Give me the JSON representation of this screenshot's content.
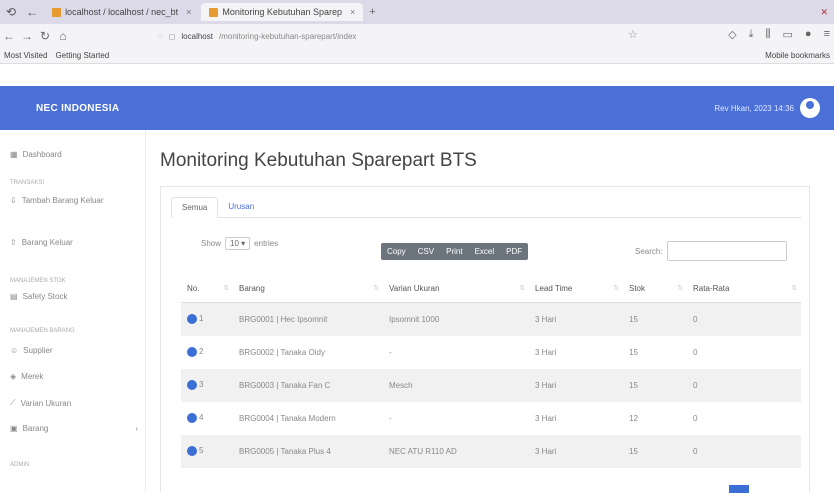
{
  "browser": {
    "tabs": [
      {
        "label": "localhost / localhost / nec_bt"
      },
      {
        "label": "Monitoring Kebutuhan Sparep"
      }
    ],
    "url_host": "localhost",
    "url_path": "/monitoring-kebutuhan-sparepart/index",
    "bookmarks": [
      "Most Visited",
      "Getting Started"
    ],
    "bookmarks_right": "Mobile bookmarks"
  },
  "header": {
    "brand": "NEC INDONESIA",
    "user": "Rev Hkan, 2023 14:36"
  },
  "sidebar": {
    "items": [
      {
        "label": "Dashboard",
        "icon": "grid-icon",
        "section": false
      },
      {
        "label": "Transaksi",
        "section": true
      },
      {
        "label": "Tambah Barang Keluar",
        "icon": "download-icon",
        "section": false
      },
      {
        "label": "Barang Keluar",
        "icon": "upload-icon",
        "section": false
      },
      {
        "label": "Manajemen Stok",
        "section": true
      },
      {
        "label": "Safety Stock",
        "icon": "chart-icon",
        "section": false
      },
      {
        "label": "Manajemen Barang",
        "section": true
      },
      {
        "label": "Supplier",
        "icon": "user-icon",
        "section": false
      },
      {
        "label": "Merek",
        "icon": "tag-icon",
        "section": false
      },
      {
        "label": "Varian Ukuran",
        "icon": "ruler-icon",
        "section": false
      },
      {
        "label": "Barang",
        "icon": "box-icon",
        "section": false,
        "chevron": "‹"
      },
      {
        "label": "Admin",
        "section": true
      }
    ]
  },
  "main": {
    "title": "Monitoring Kebutuhan Sparepart BTS",
    "tabs": [
      "Semua",
      "Urusan"
    ],
    "show_label": "Show",
    "show_value": "10",
    "entries_label": "entries",
    "buttons": [
      "Copy",
      "CSV",
      "Print",
      "Excel",
      "PDF"
    ],
    "search_label": "Search:",
    "table": {
      "headers": [
        "No.",
        "Barang",
        "Varian Ukuran",
        "Lead Time",
        "Stok",
        "Rata-Rata"
      ],
      "rows": [
        [
          "1",
          "BRG0001 | Hec Ipsomnit",
          "Ipsomnit 1000",
          "3 Hari",
          "15",
          "0"
        ],
        [
          "2",
          "BRG0002 | Tanaka Oidy",
          "-",
          "3 Hari",
          "15",
          "0"
        ],
        [
          "3",
          "BRG0003 | Tanaka Fan C",
          "Mesch",
          "3 Hari",
          "15",
          "0"
        ],
        [
          "4",
          "BRG0004 | Tanaka Modern",
          "-",
          "3 Hari",
          "12",
          "0"
        ],
        [
          "5",
          "BRG0005 | Tanaka Plus 4",
          "NEC ATU R110 AD",
          "3 Hari",
          "15",
          "0"
        ]
      ]
    }
  }
}
